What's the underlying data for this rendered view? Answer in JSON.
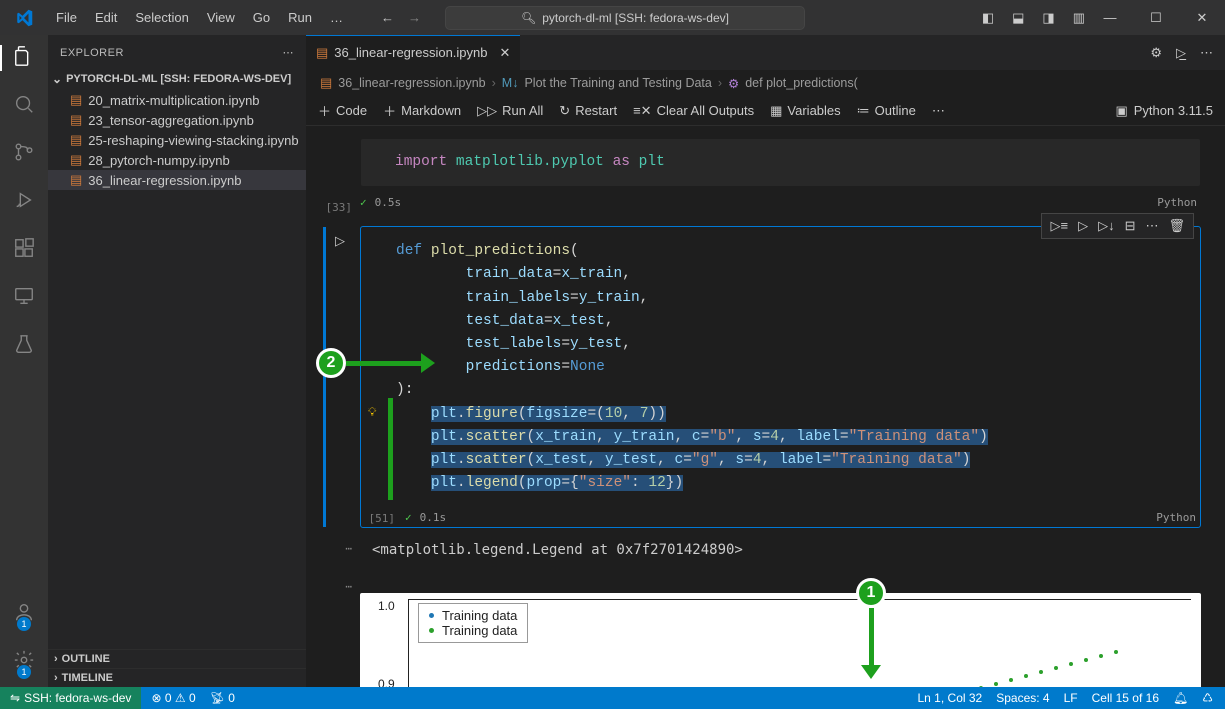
{
  "title_bar": {
    "menus": [
      "File",
      "Edit",
      "Selection",
      "View",
      "Go",
      "Run",
      "…"
    ],
    "search": "pytorch-dl-ml [SSH: fedora-ws-dev]"
  },
  "explorer": {
    "title": "EXPLORER",
    "root": "PYTORCH-DL-ML [SSH: FEDORA-WS-DEV]",
    "files": [
      "20_matrix-multiplication.ipynb",
      "23_tensor-aggregation.ipynb",
      "25-reshaping-viewing-stacking.ipynb",
      "28_pytorch-numpy.ipynb",
      "36_linear-regression.ipynb"
    ],
    "sections": [
      "OUTLINE",
      "TIMELINE"
    ]
  },
  "tab": {
    "label": "36_linear-regression.ipynb"
  },
  "breadcrumb": {
    "a": "36_linear-regression.ipynb",
    "b": "Plot the Training and Testing Data",
    "c": "def plot_predictions("
  },
  "toolbar": {
    "code": "Code",
    "markdown": "Markdown",
    "run_all": "Run All",
    "restart": "Restart",
    "clear": "Clear All Outputs",
    "variables": "Variables",
    "outline": "Outline",
    "kernel": "Python 3.11.5"
  },
  "cell1": {
    "prompt": "[33]",
    "time": "0.5s",
    "lang": "Python",
    "line": {
      "imp": "import",
      "mod": "matplotlib.pyplot",
      "as": "as",
      "alias": "plt"
    }
  },
  "cell2": {
    "prompt": "[51]",
    "time": "0.1s",
    "lang": "Python",
    "def": "def",
    "fn": "plot_predictions",
    "p1a": "train_data",
    "p1b": "x_train",
    "p2a": "train_labels",
    "p2b": "y_train",
    "p3a": "test_data",
    "p3b": "x_test",
    "p4a": "test_labels",
    "p4b": "y_test",
    "p5a": "predictions",
    "p5b": "None",
    "l1_a": "plt",
    "l1_fn": "figure",
    "l1_kw": "figsize",
    "l1_n1": "10",
    "l1_n2": "7",
    "l2_a": "plt",
    "l2_fn": "scatter",
    "l2_v1": "x_train",
    "l2_v2": "y_train",
    "l2_kwc": "c",
    "l2_cs": "\"b\"",
    "l2_kws": "s",
    "l2_sn": "4",
    "l2_kwl": "label",
    "l2_ls": "\"Training data\"",
    "l3_a": "plt",
    "l3_fn": "scatter",
    "l3_v1": "x_test",
    "l3_v2": "y_test",
    "l3_kwc": "c",
    "l3_cs": "\"g\"",
    "l3_kws": "s",
    "l3_sn": "4",
    "l3_kwl": "label",
    "l3_ls": "\"Training data\"",
    "l4_a": "plt",
    "l4_fn": "legend",
    "l4_kw": "prop",
    "l4_dk": "\"size\"",
    "l4_dv": "12"
  },
  "output_text": "<matplotlib.legend.Legend at 0x7f2701424890>",
  "plot": {
    "ytick1": "1.0",
    "ytick2": "0.9",
    "leg1": "Training data",
    "leg2": "Training data"
  },
  "status": {
    "remote": "SSH: fedora-ws-dev",
    "errors": "0",
    "warnings": "0",
    "port": "0",
    "pos": "Ln 1, Col 32",
    "spaces": "Spaces: 4",
    "eol": "LF",
    "cell": "Cell 15 of 16"
  },
  "annot": {
    "n1": "1",
    "n2": "2"
  },
  "chart_data": {
    "type": "scatter",
    "title": "",
    "xlabel": "",
    "ylabel": "",
    "ylim": [
      0.9,
      1.0
    ],
    "series": [
      {
        "name": "Training data",
        "color": "#1f77b4",
        "values": []
      },
      {
        "name": "Training data",
        "color": "#2ca02c",
        "values": []
      }
    ],
    "legend_position": "upper-left",
    "note": "Plot is cropped in screenshot; only y-ticks 1.0 and 0.9 and a diagonal trail of green points in the upper-right are visible. Underlying data points not readable."
  }
}
